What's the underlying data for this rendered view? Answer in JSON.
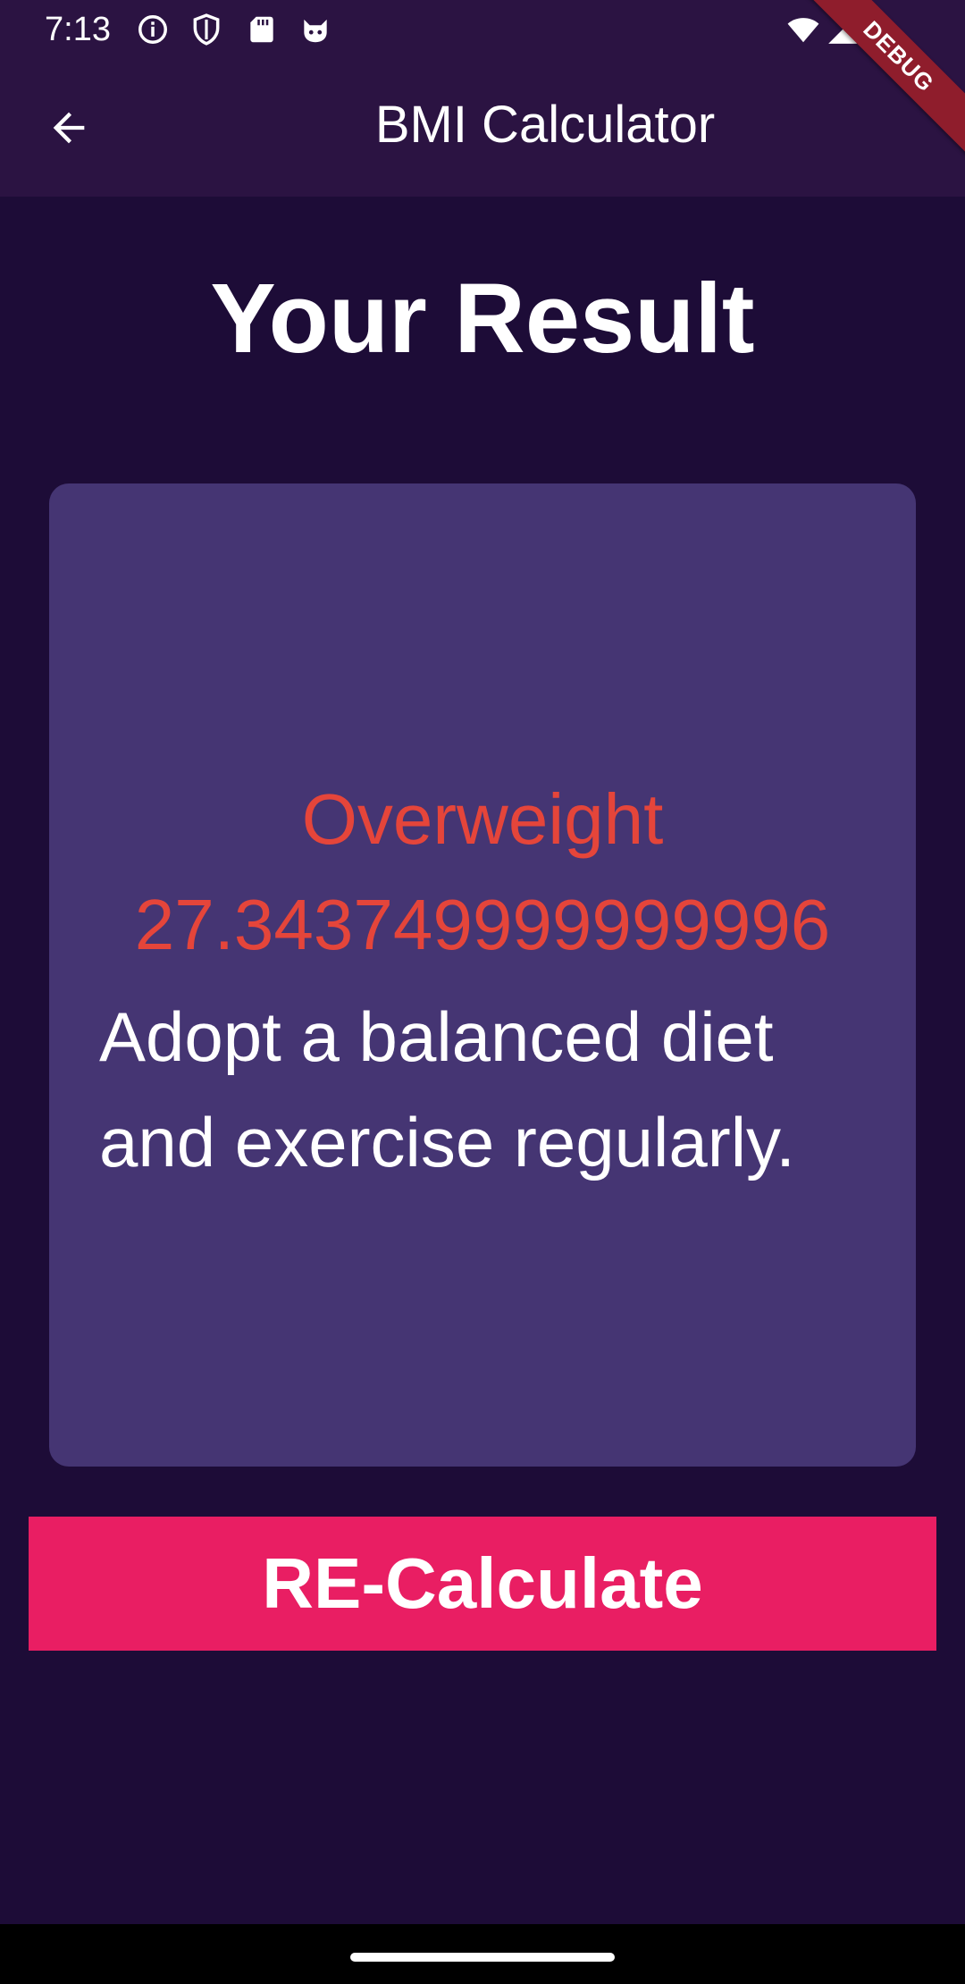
{
  "status_bar": {
    "time": "7:13",
    "icons": [
      "info-icon",
      "shield-icon",
      "sd-card-icon",
      "cat-icon",
      "wifi-icon",
      "signal-icon",
      "battery-icon"
    ]
  },
  "app_bar": {
    "title": "BMI Calculator",
    "back_icon": "arrow-back-icon"
  },
  "debug_banner": "DEBUG",
  "page": {
    "heading": "Your Result"
  },
  "result": {
    "status": "Overweight",
    "value": "27.343749999999996",
    "advice": "Adopt a balanced diet and exercise regularly."
  },
  "button": {
    "label": "RE-Calculate"
  },
  "colors": {
    "background": "#1d0c37",
    "app_bar": "#2b1342",
    "card": "#453573",
    "result_text": "#e5453a",
    "button": "#e91e63"
  }
}
